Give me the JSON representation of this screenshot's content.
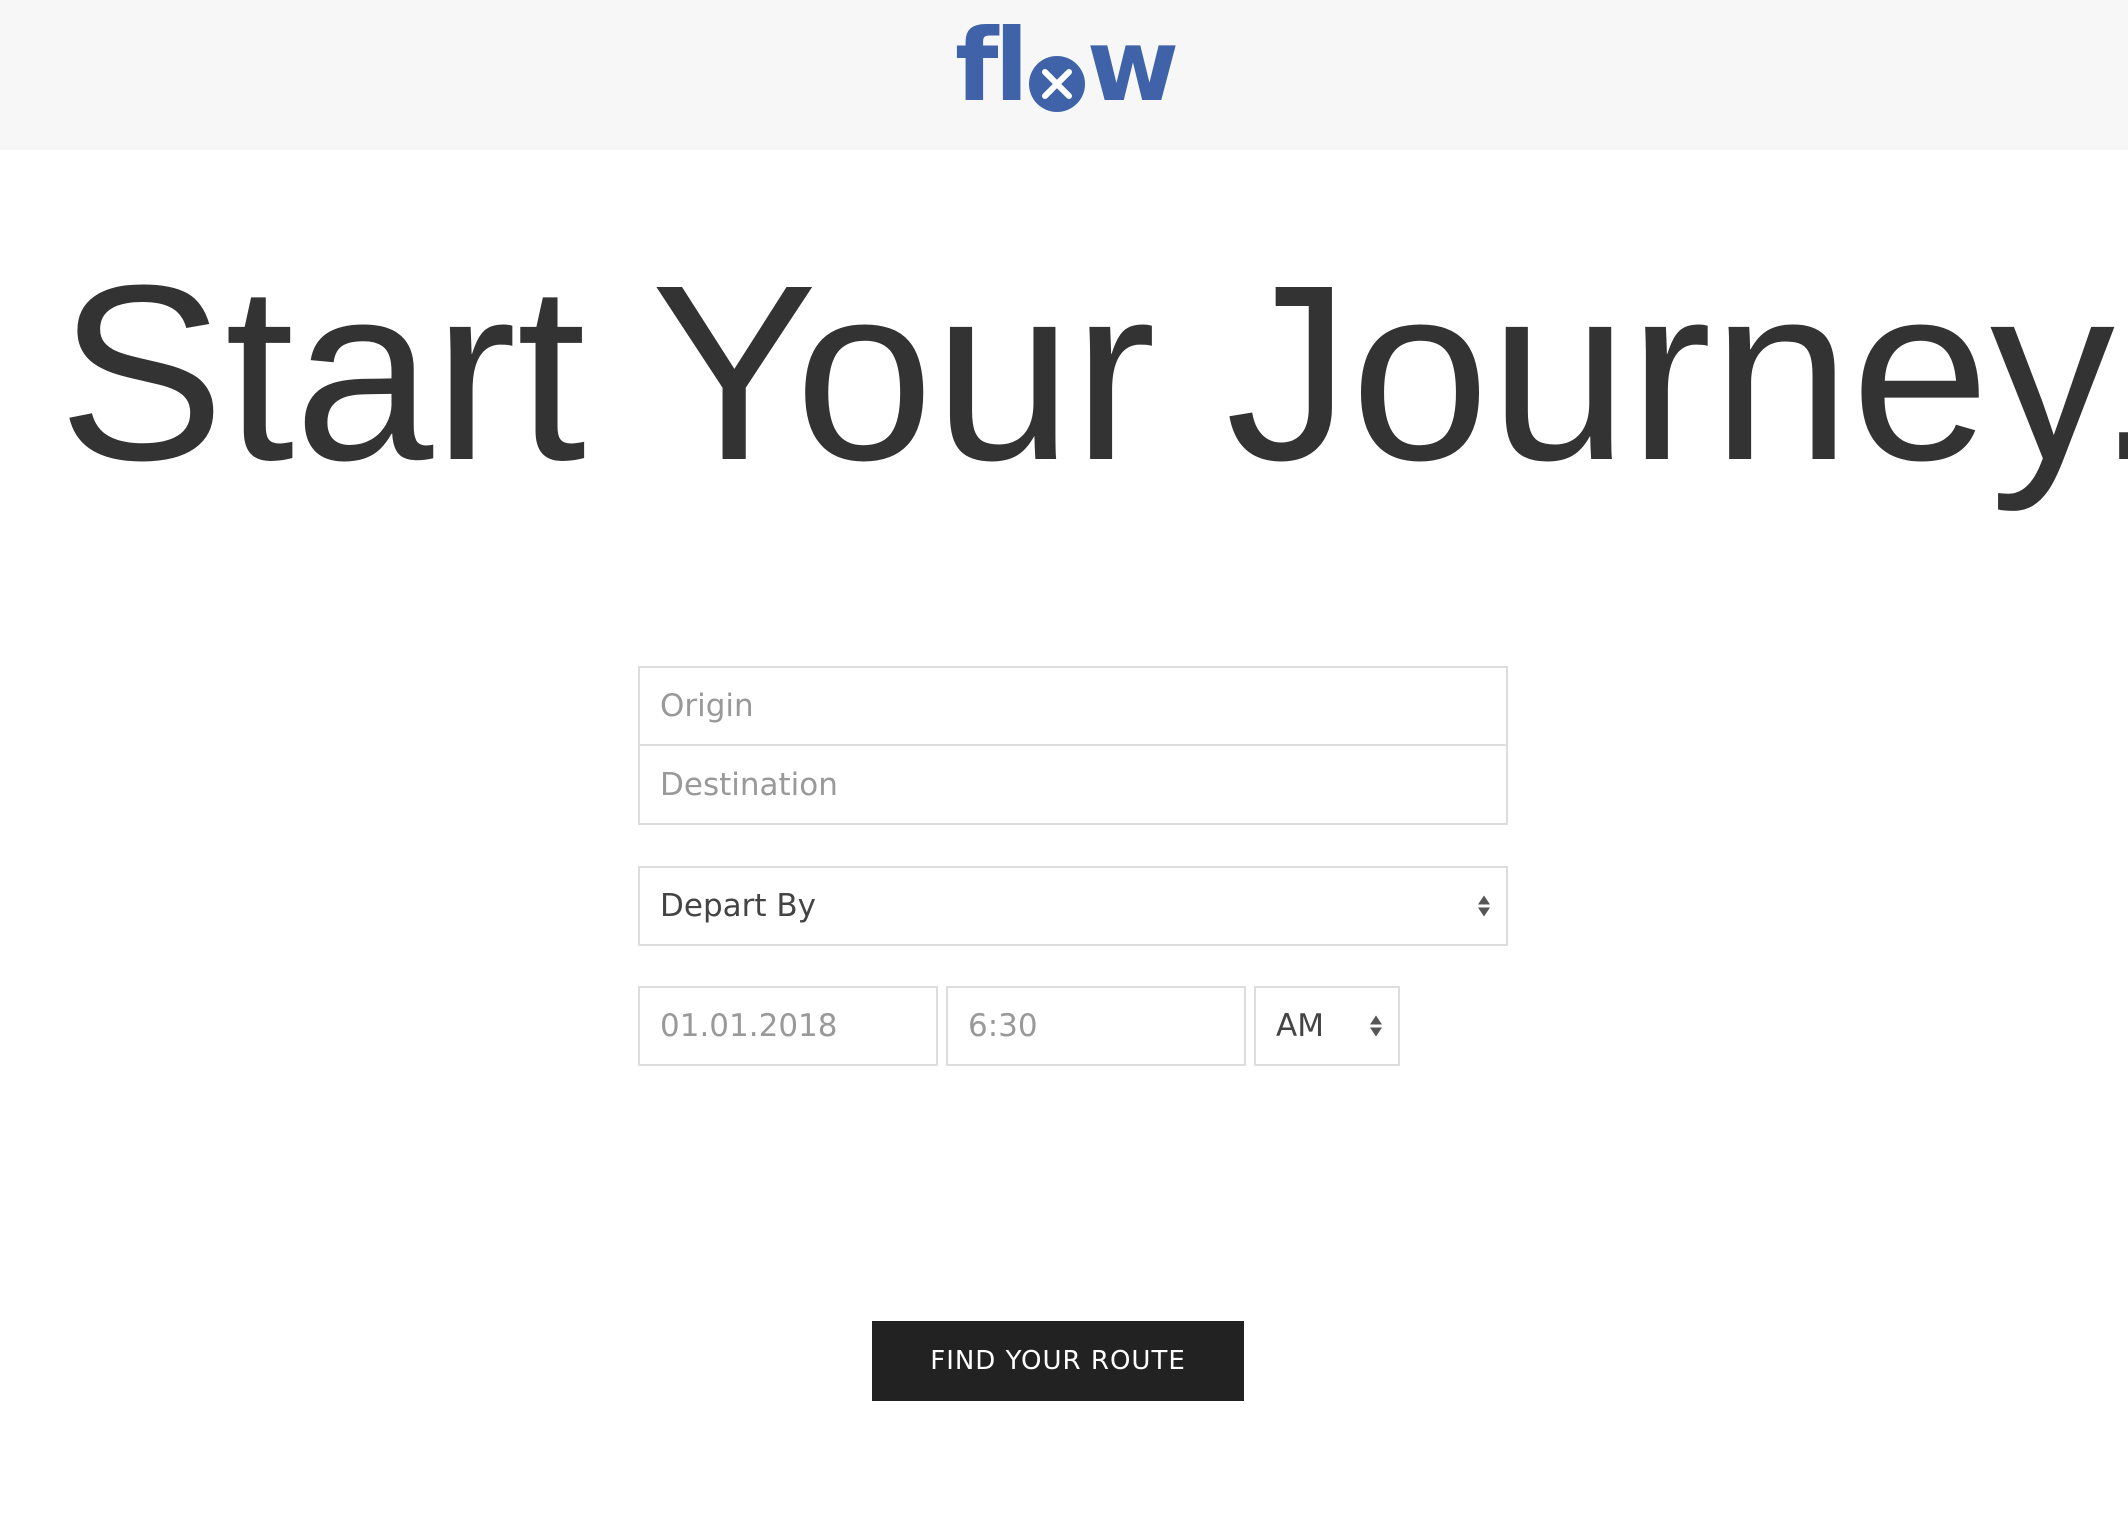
{
  "header": {
    "logo_text": "flow",
    "logo_prefix": "fl",
    "logo_suffix": "w",
    "brand_color": "#3f62a8"
  },
  "hero": {
    "headline": "Start Your Journey."
  },
  "form": {
    "origin_placeholder": "Origin",
    "destination_placeholder": "Destination",
    "mode_select_value": "Depart By",
    "date_value": "01.01.2018",
    "time_value": "6:30",
    "ampm_value": "AM",
    "submit_label": "FIND YOUR ROUTE"
  },
  "icons": {
    "logo_mark": "x-circle-icon",
    "select_arrows": "updown-arrows-icon"
  }
}
